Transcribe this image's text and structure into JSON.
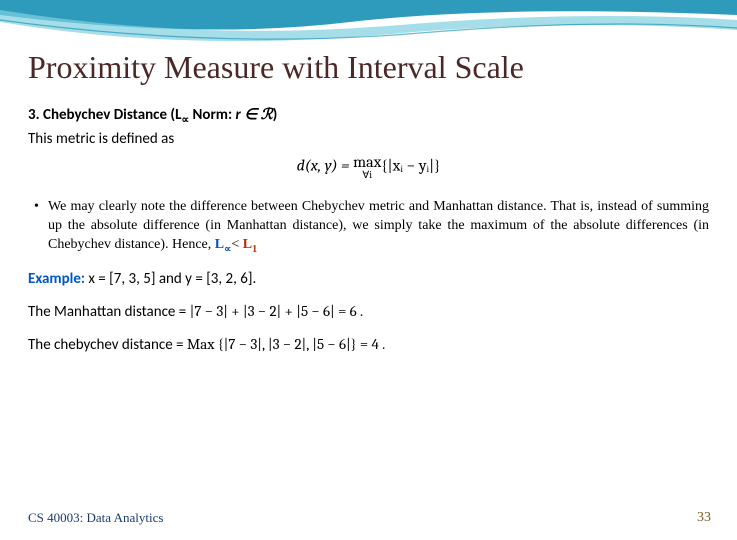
{
  "title": "Proximity Measure with Interval Scale",
  "section": {
    "number_label": "3. Chebychev Distance (L",
    "norm_sub": "∝",
    "norm_after": " Norm: ",
    "r_cond": "r ∈ ℛ",
    "close_paren": ")",
    "lead": "This metric is defined as"
  },
  "formula": {
    "lhs": "d(x, y) = ",
    "max_top": "max",
    "max_sub": "∀i",
    "rhs": "{|xᵢ − yᵢ|}"
  },
  "explain": {
    "text_before": "We may clearly note the difference between Chebychev metric and Manhattan distance. That is, instead of summing up the absolute difference (in Manhattan distance), we simply take the maximum of the absolute differences (in Chebychev distance). Hence, ",
    "l_alpha": "L",
    "l_alpha_sub": "∝",
    "lt": "< ",
    "l_one": "L",
    "l_one_sub": "1"
  },
  "example": {
    "label": "Example:",
    "vectors": " x = [7, 3, 5] and y = [3, 2, 6]."
  },
  "manhattan": {
    "label": "The Manhattan distance = ",
    "expr": "|7 − 3| + |3 − 2| + |5 − 6| = 6 ."
  },
  "chebychev": {
    "label": "The chebychev distance = ",
    "maxword": "Max ",
    "expr": "{|7 − 3|, |3 − 2|, |5 − 6|} = 4 ."
  },
  "footer": {
    "course": "CS 40003: Data Analytics",
    "page": "33"
  }
}
